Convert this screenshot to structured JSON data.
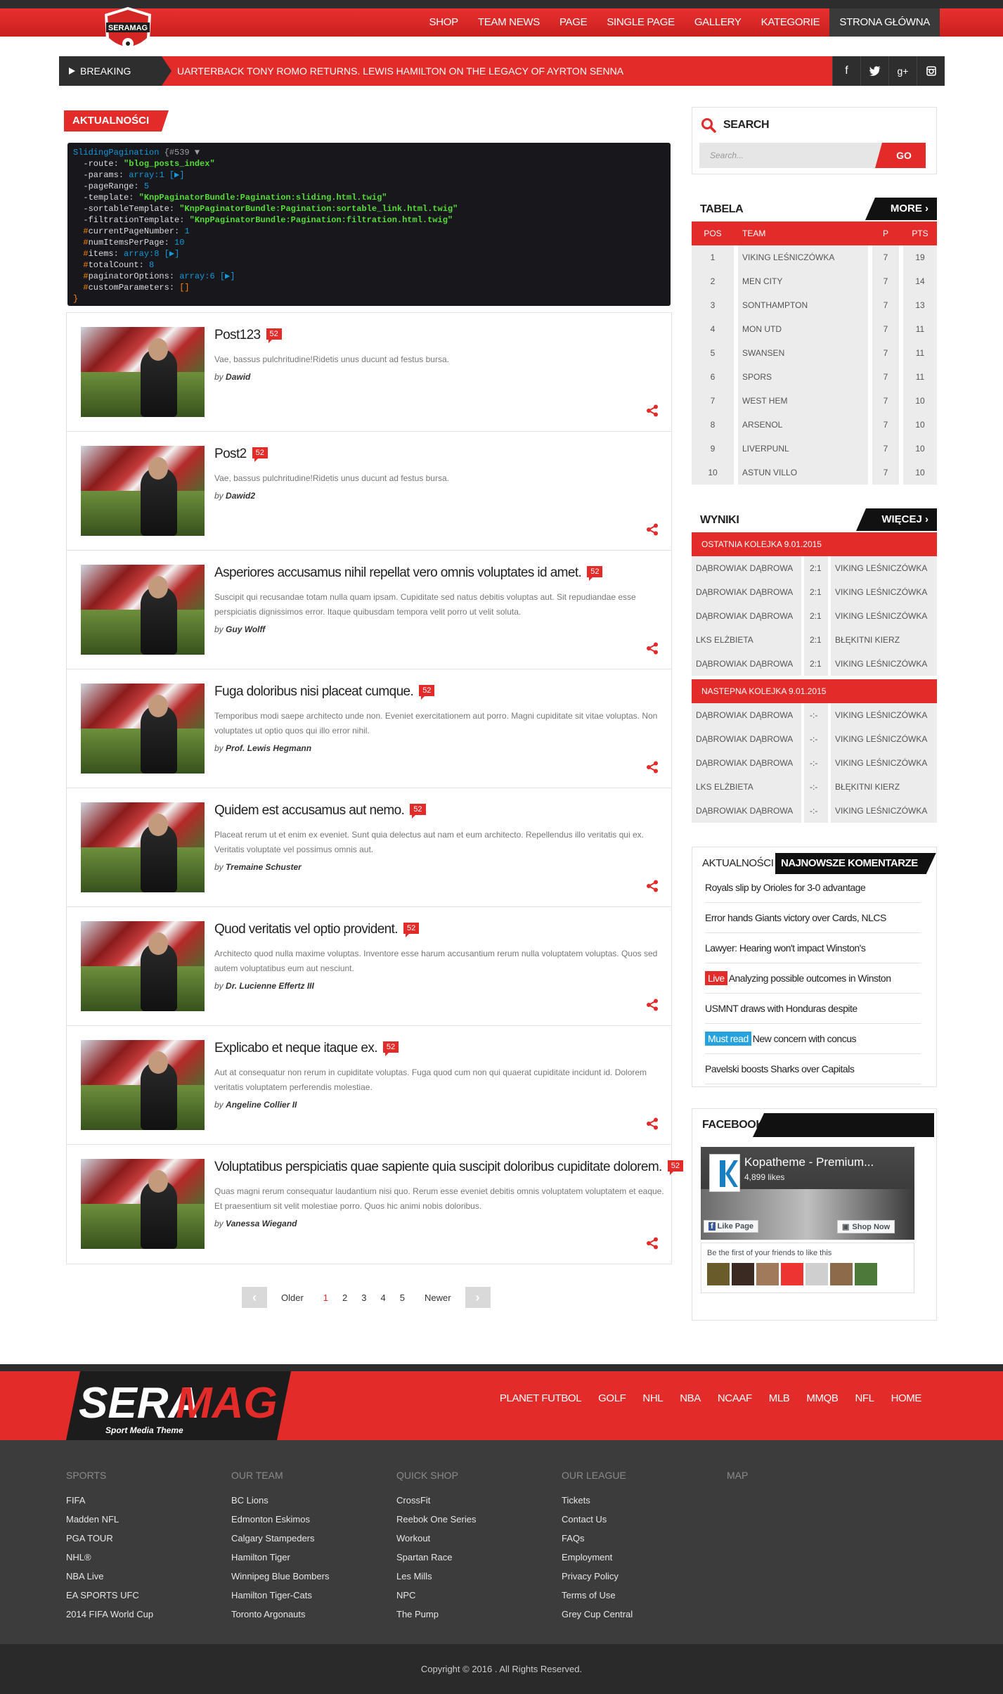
{
  "nav": {
    "logo_text": "SERAMAG",
    "items": [
      "SHOP",
      "TEAM NEWS",
      "PAGE",
      "SINGLE PAGE",
      "GALLERY",
      "KATEGORIE",
      "STRONA GŁÓWNA"
    ]
  },
  "breaking": {
    "label": "BREAKING NEWS",
    "text": "UARTERBACK TONY ROMO RETURNS. LEWIS HAMILTON ON THE LEGACY OF AYRTON SENNA",
    "social": [
      "facebook-icon",
      "twitter-icon",
      "googleplus-icon",
      "instagram-icon"
    ]
  },
  "main": {
    "section_title": "AKTUALNOŚCI",
    "dump": {
      "header_class": "SlidingPagination",
      "header_id": "{#539 ▼",
      "route": "\"blog_posts_index\"",
      "params": "array:1 [▶]",
      "pageRange": "5",
      "template": "\"KnpPaginatorBundle:Pagination:sliding.html.twig\"",
      "sortableTemplate": "\"KnpPaginatorBundle:Pagination:sortable_link.html.twig\"",
      "filtrationTemplate": "\"KnpPaginatorBundle:Pagination:filtration.html.twig\"",
      "currentPageNumber": "1",
      "numItemsPerPage": "10",
      "items": "array:8 [▶]",
      "totalCount": "8",
      "paginatorOptions": "array:6 [▶]",
      "customParameters": "[]",
      "close": "}"
    },
    "posts": [
      {
        "title": "Post123",
        "comments": "52",
        "excerpt": "Vae, bassus pulchritudine!Ridetis unus ducunt ad festus bursa.",
        "by": "by",
        "author": "Dawid"
      },
      {
        "title": "Post2",
        "comments": "52",
        "excerpt": "Vae, bassus pulchritudine!Ridetis unus ducunt ad festus bursa.",
        "by": "by",
        "author": "Dawid2"
      },
      {
        "title": "Asperiores accusamus nihil repellat vero omnis voluptates id amet.",
        "comments": "52",
        "excerpt": "Suscipit qui recusandae totam nulla quam ipsam. Cupiditate sed natus debitis voluptas aut. Sit repudiandae esse perspiciatis dignissimos error. Itaque quibusdam tempora velit porro ut velit soluta.",
        "by": "by",
        "author": "Guy Wolff"
      },
      {
        "title": "Fuga doloribus nisi placeat cumque.",
        "comments": "52",
        "excerpt": "Temporibus modi saepe architecto unde non. Eveniet exercitationem aut porro. Magni cupiditate sit vitae voluptas. Non voluptates ut optio quos qui illo error nihil.",
        "by": "by",
        "author": "Prof. Lewis Hegmann"
      },
      {
        "title": "Quidem est accusamus aut nemo.",
        "comments": "52",
        "excerpt": "Placeat rerum ut et enim ex eveniet. Sunt quia delectus aut nam et eum architecto. Repellendus illo veritatis qui ex. Veritatis voluptate vel possimus omnis aut.",
        "by": "by",
        "author": "Tremaine Schuster"
      },
      {
        "title": "Quod veritatis vel optio provident.",
        "comments": "52",
        "excerpt": "Architecto quod nulla maxime voluptas. Inventore esse harum accusantium rerum nulla voluptatem voluptas. Quos sed autem voluptatibus eum aut nesciunt.",
        "by": "by",
        "author": "Dr. Lucienne Effertz III"
      },
      {
        "title": "Explicabo et neque itaque ex.",
        "comments": "52",
        "excerpt": "Aut at consequatur non rerum in cupiditate voluptas. Fuga quod cum non qui quaerat cupiditate incidunt id. Dolorem veritatis voluptatem perferendis molestiae.",
        "by": "by",
        "author": "Angeline Collier II"
      },
      {
        "title": "Voluptatibus perspiciatis quae sapiente quia suscipit doloribus cupiditate dolorem.",
        "comments": "52",
        "excerpt": "Quas magni rerum consequatur laudantium nisi quo. Rerum esse eveniet debitis omnis voluptatem voluptatem et eaque. Et praesentium sit velit molestiae porro. Quos hic animi nobis doloribus.",
        "by": "by",
        "author": "Vanessa Wiegand"
      }
    ],
    "pager": {
      "prev": "‹",
      "older": "Older",
      "pages": [
        "1",
        "2",
        "3",
        "4",
        "5"
      ],
      "newer": "Newer",
      "next": "›",
      "current": "1"
    }
  },
  "sidebar": {
    "search": {
      "title": "SEARCH",
      "placeholder": "Search...",
      "button": "GO"
    },
    "standings": {
      "title": "TABELA",
      "more": "MORE",
      "headers": [
        "POS",
        "TEAM",
        "P",
        "PTS"
      ],
      "rows": [
        [
          "1",
          "VIKING LEŚNICZÓWKA",
          "7",
          "19"
        ],
        [
          "2",
          "MEN CITY",
          "7",
          "14"
        ],
        [
          "3",
          "SONTHAMPTON",
          "7",
          "13"
        ],
        [
          "4",
          "MON UTD",
          "7",
          "11"
        ],
        [
          "5",
          "SWANSEN",
          "7",
          "11"
        ],
        [
          "6",
          "SPORS",
          "7",
          "11"
        ],
        [
          "7",
          "WEST HEM",
          "7",
          "10"
        ],
        [
          "8",
          "ARSENOL",
          "7",
          "10"
        ],
        [
          "9",
          "LIVERPUNL",
          "7",
          "10"
        ],
        [
          "10",
          "ASTUN VILLO",
          "7",
          "10"
        ]
      ]
    },
    "results": {
      "title": "WYNIKI",
      "more": "WIĘCEJ",
      "last_round": "OSTATNIA KOLEJKA 9.01.2015",
      "last": [
        [
          "DĄBROWIAK DĄBROWA",
          "2:1",
          "VIKING LEŚNICZÓWKA"
        ],
        [
          "DĄBROWIAK DĄBROWA",
          "2:1",
          "VIKING LEŚNICZÓWKA"
        ],
        [
          "DĄBROWIAK DĄBROWA",
          "2:1",
          "VIKING LEŚNICZÓWKA"
        ],
        [
          "LKS ELŻBIETA",
          "2:1",
          "BŁĘKITNI KIERZ"
        ],
        [
          "DĄBROWIAK DĄBROWA",
          "2:1",
          "VIKING LEŚNICZÓWKA"
        ]
      ],
      "next_round": "NASTEPNA KOLEJKA 9.01.2015",
      "next": [
        [
          "DĄBROWIAK DĄBROWA",
          "-:-",
          "VIKING LEŚNICZÓWKA"
        ],
        [
          "DĄBROWIAK DĄBROWA",
          "-:-",
          "VIKING LEŚNICZÓWKA"
        ],
        [
          "DĄBROWIAK DĄBROWA",
          "-:-",
          "VIKING LEŚNICZÓWKA"
        ],
        [
          "LKS ELŻBIETA",
          "-:-",
          "BŁĘKITNI KIERZ"
        ],
        [
          "DĄBROWIAK DĄBROWA",
          "-:-",
          "VIKING LEŚNICZÓWKA"
        ]
      ]
    },
    "comments": {
      "tab1": "AKTUALNOŚCI",
      "tab2": "NAJNOWSZE KOMENTARZE",
      "items": [
        {
          "tag": "",
          "text": "Royals slip by Orioles for 3-0 advantage"
        },
        {
          "tag": "",
          "text": "Error hands Giants victory over Cards, NLCS"
        },
        {
          "tag": "",
          "text": "Lawyer: Hearing won't impact Winston's"
        },
        {
          "tag": "Live",
          "text": "Analyzing possible outcomes in Winston"
        },
        {
          "tag": "",
          "text": "USMNT draws with Honduras despite"
        },
        {
          "tag": "Must read",
          "text": "New concern with concus"
        },
        {
          "tag": "",
          "text": "Pavelski boosts Sharks over Capitals"
        }
      ]
    },
    "facebook": {
      "title": "FACEBOOK",
      "page_name": "Kopatheme - Premium...",
      "likes": "4,899 likes",
      "like_btn": "Like Page",
      "shop_btn": "Shop Now",
      "friends_text": "Be the first of your friends to like this"
    }
  },
  "footer": {
    "logo_text_1": "SERA",
    "logo_text_2": "MAG",
    "tagline": "Sport Media Theme",
    "menu": [
      "PLANET FUTBOL",
      "GOLF",
      "NHL",
      "NBA",
      "NCAAF",
      "MLB",
      "MMQB",
      "NFL",
      "HOME"
    ],
    "columns": [
      {
        "title": "SPORTS",
        "links": [
          "FIFA",
          "Madden NFL",
          "PGA TOUR",
          "NHL®",
          "NBA Live",
          "EA SPORTS UFC",
          "2014 FIFA World Cup"
        ]
      },
      {
        "title": "OUR TEAM",
        "links": [
          "BC Lions",
          "Edmonton Eskimos",
          "Calgary Stampeders",
          "Hamilton Tiger",
          "Winnipeg Blue Bombers",
          "Hamilton Tiger-Cats",
          "Toronto Argonauts"
        ]
      },
      {
        "title": "QUICK SHOP",
        "links": [
          "CrossFit",
          "Reebok One Series",
          "Workout",
          "Spartan Race",
          "Les Mills",
          "NPC",
          "The Pump"
        ]
      },
      {
        "title": "OUR LEAGUE",
        "links": [
          "Tickets",
          "Contact Us",
          "FAQs",
          "Employment",
          "Privacy Policy",
          "Terms of Use",
          "Grey Cup Central"
        ]
      },
      {
        "title": "MAP",
        "links": []
      }
    ],
    "copyright": "Copyright © 2016 . All Rights Reserved."
  },
  "colors": {
    "accent": "#e32b2a",
    "dark": "#2e2e2e",
    "footer": "#3c3c3c"
  }
}
